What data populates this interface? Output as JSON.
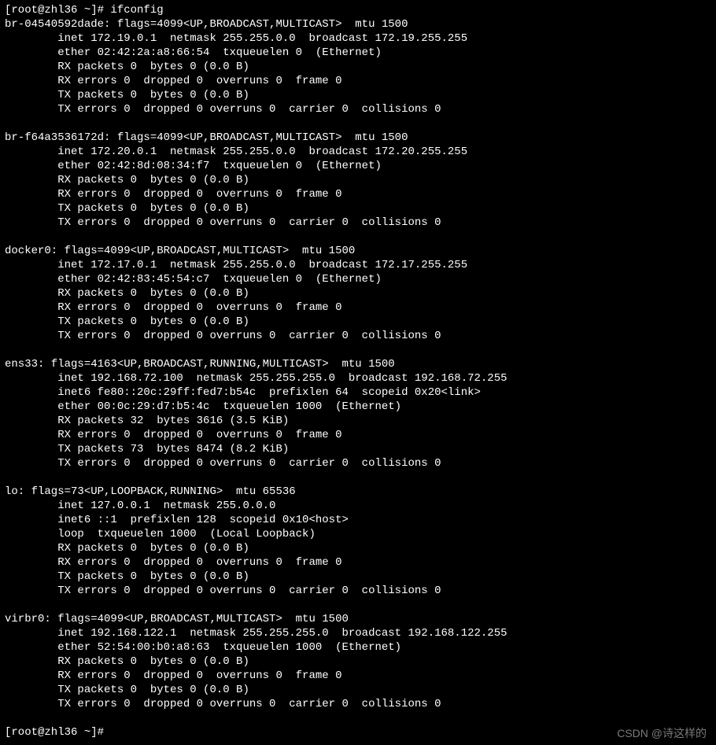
{
  "prompt1": "[root@zhl36 ~]# ifconfig",
  "prompt2": "[root@zhl36 ~]# ",
  "watermark": "CSDN @诗这样的",
  "interfaces": [
    {
      "name": "br-04540592dade",
      "flags": "flags=4099<UP,BROADCAST,MULTICAST>  mtu 1500",
      "lines": [
        "inet 172.19.0.1  netmask 255.255.0.0  broadcast 172.19.255.255",
        "ether 02:42:2a:a8:66:54  txqueuelen 0  (Ethernet)",
        "RX packets 0  bytes 0 (0.0 B)",
        "RX errors 0  dropped 0  overruns 0  frame 0",
        "TX packets 0  bytes 0 (0.0 B)",
        "TX errors 0  dropped 0 overruns 0  carrier 0  collisions 0"
      ]
    },
    {
      "name": "br-f64a3536172d",
      "flags": "flags=4099<UP,BROADCAST,MULTICAST>  mtu 1500",
      "lines": [
        "inet 172.20.0.1  netmask 255.255.0.0  broadcast 172.20.255.255",
        "ether 02:42:8d:08:34:f7  txqueuelen 0  (Ethernet)",
        "RX packets 0  bytes 0 (0.0 B)",
        "RX errors 0  dropped 0  overruns 0  frame 0",
        "TX packets 0  bytes 0 (0.0 B)",
        "TX errors 0  dropped 0 overruns 0  carrier 0  collisions 0"
      ]
    },
    {
      "name": "docker0",
      "flags": "flags=4099<UP,BROADCAST,MULTICAST>  mtu 1500",
      "lines": [
        "inet 172.17.0.1  netmask 255.255.0.0  broadcast 172.17.255.255",
        "ether 02:42:83:45:54:c7  txqueuelen 0  (Ethernet)",
        "RX packets 0  bytes 0 (0.0 B)",
        "RX errors 0  dropped 0  overruns 0  frame 0",
        "TX packets 0  bytes 0 (0.0 B)",
        "TX errors 0  dropped 0 overruns 0  carrier 0  collisions 0"
      ]
    },
    {
      "name": "ens33",
      "flags": "flags=4163<UP,BROADCAST,RUNNING,MULTICAST>  mtu 1500",
      "lines": [
        "inet 192.168.72.100  netmask 255.255.255.0  broadcast 192.168.72.255",
        "inet6 fe80::20c:29ff:fed7:b54c  prefixlen 64  scopeid 0x20<link>",
        "ether 00:0c:29:d7:b5:4c  txqueuelen 1000  (Ethernet)",
        "RX packets 32  bytes 3616 (3.5 KiB)",
        "RX errors 0  dropped 0  overruns 0  frame 0",
        "TX packets 73  bytes 8474 (8.2 KiB)",
        "TX errors 0  dropped 0 overruns 0  carrier 0  collisions 0"
      ]
    },
    {
      "name": "lo",
      "flags": "flags=73<UP,LOOPBACK,RUNNING>  mtu 65536",
      "lines": [
        "inet 127.0.0.1  netmask 255.0.0.0",
        "inet6 ::1  prefixlen 128  scopeid 0x10<host>",
        "loop  txqueuelen 1000  (Local Loopback)",
        "RX packets 0  bytes 0 (0.0 B)",
        "RX errors 0  dropped 0  overruns 0  frame 0",
        "TX packets 0  bytes 0 (0.0 B)",
        "TX errors 0  dropped 0 overruns 0  carrier 0  collisions 0"
      ]
    },
    {
      "name": "virbr0",
      "flags": "flags=4099<UP,BROADCAST,MULTICAST>  mtu 1500",
      "lines": [
        "inet 192.168.122.1  netmask 255.255.255.0  broadcast 192.168.122.255",
        "ether 52:54:00:b0:a8:63  txqueuelen 1000  (Ethernet)",
        "RX packets 0  bytes 0 (0.0 B)",
        "RX errors 0  dropped 0  overruns 0  frame 0",
        "TX packets 0  bytes 0 (0.0 B)",
        "TX errors 0  dropped 0 overruns 0  carrier 0  collisions 0"
      ]
    }
  ]
}
